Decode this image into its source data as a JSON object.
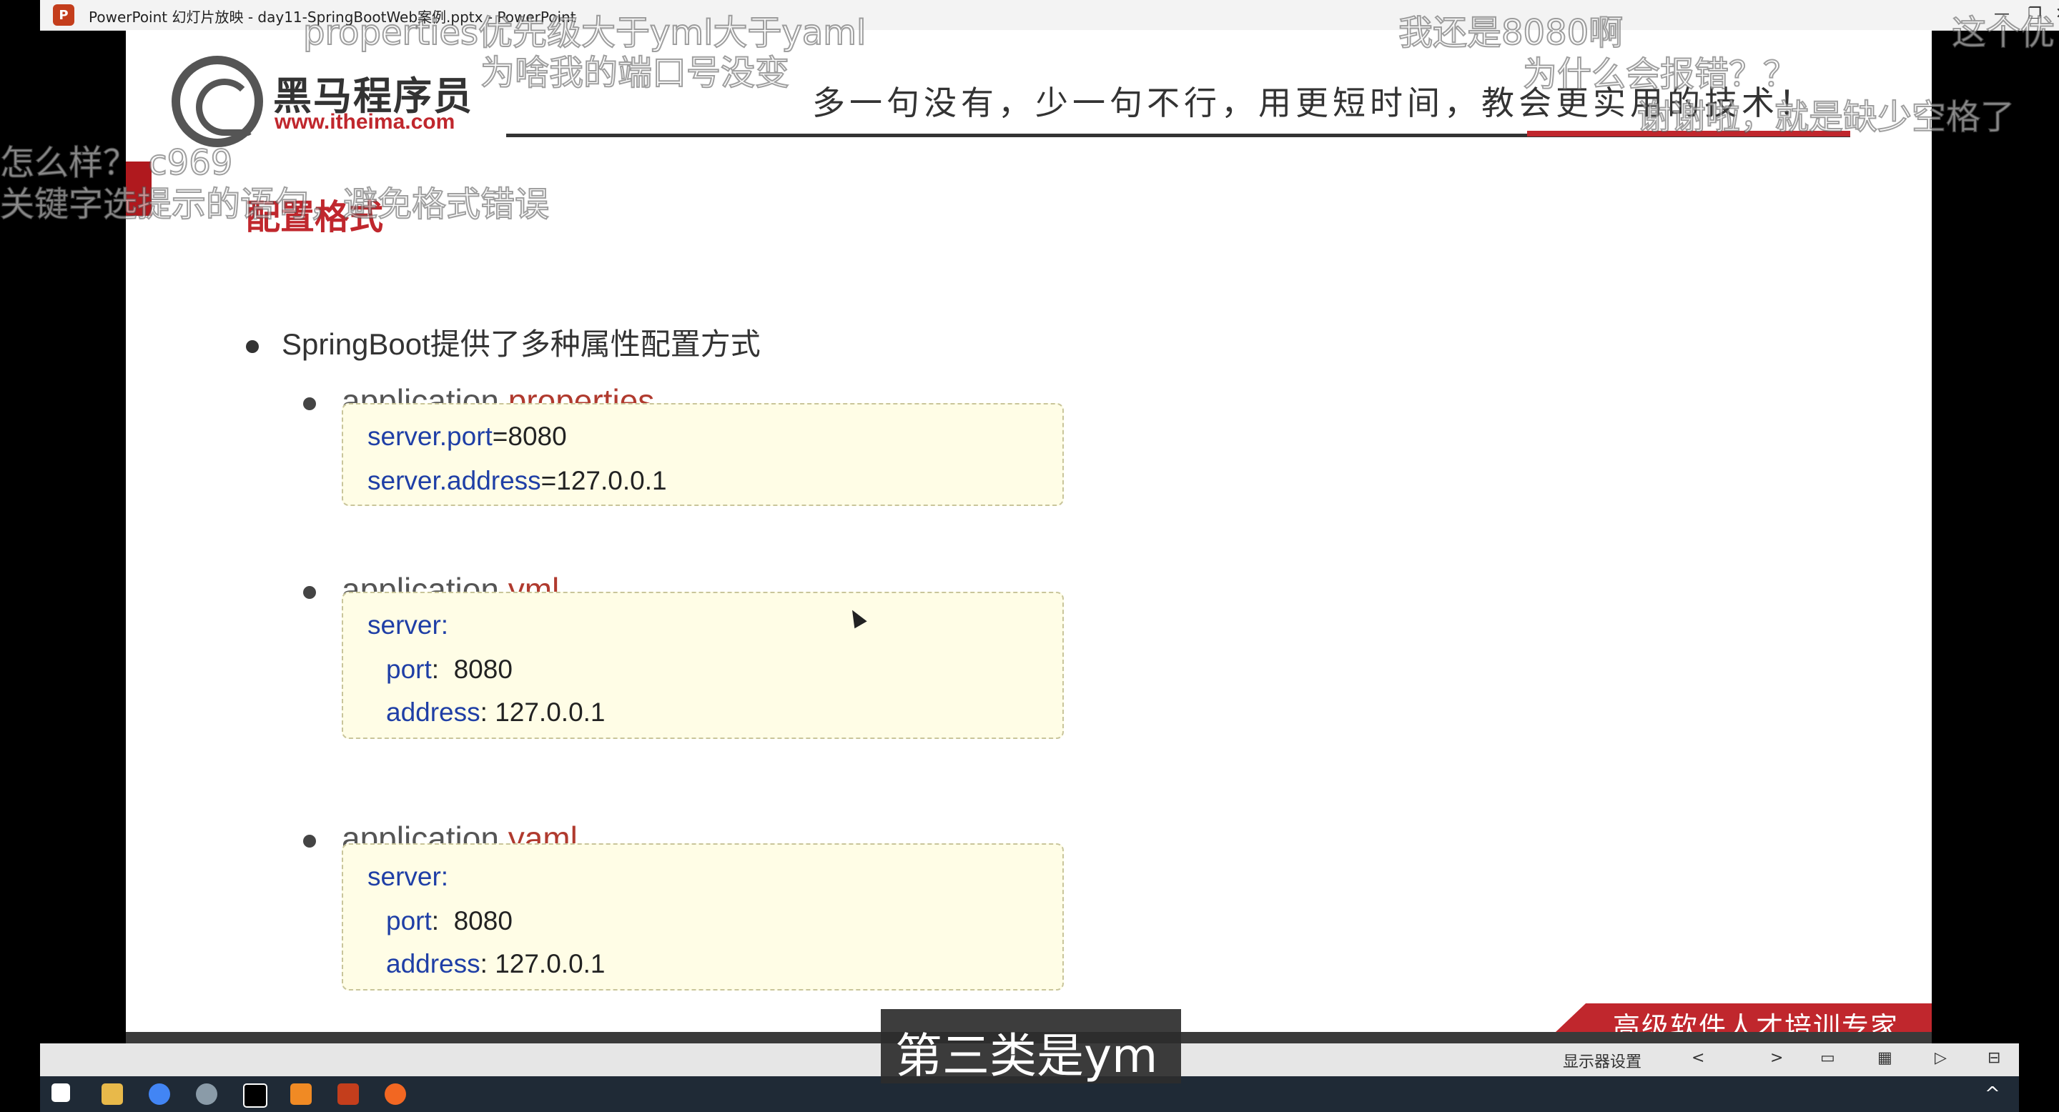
{
  "window": {
    "title": "PowerPoint 幻灯片放映 - day11-SpringBootWeb案例.pptx - PowerPoint",
    "app_icon": "powerpoint-icon",
    "controls": [
      "—",
      "❐",
      "✕"
    ]
  },
  "slide": {
    "brand_name": "黑马程序员",
    "brand_url": "www.itheima.com",
    "slogan": "多一句没有，少一句不行，用更短时间，教会更实用的技术！",
    "section_title": "配置格式",
    "main_bullet": "SpringBoot提供了多种属性配置方式",
    "formats": [
      {
        "prefix": "application.",
        "ext": "properties",
        "lines": [
          {
            "key": "server.port",
            "sep": "=",
            "value": "8080"
          },
          {
            "key": "server.address",
            "sep": "=",
            "value": "127.0.0.1"
          }
        ]
      },
      {
        "prefix": "application.",
        "ext": "yml",
        "lines": [
          {
            "key": "server:",
            "sep": "",
            "value": ""
          },
          {
            "key": "port",
            "sep": ":",
            "value": "8080"
          },
          {
            "key": "address",
            "sep": ":",
            "value": "127.0.0.1"
          }
        ]
      },
      {
        "prefix": "application.",
        "ext": "yaml",
        "lines": [
          {
            "key": "server:",
            "sep": "",
            "value": ""
          },
          {
            "key": "port",
            "sep": ":",
            "value": "8080"
          },
          {
            "key": "address",
            "sep": ":",
            "value": "127.0.0.1"
          }
        ]
      }
    ],
    "banner": "高级软件人才培训专家"
  },
  "statusbar": {
    "display_settings": "显示器设置",
    "nav_prev": "<",
    "nav_next": ">"
  },
  "caption": "第三类是ym",
  "danmaku": [
    "properties优先级大于yml大于yaml",
    "为啥我的端口号没变",
    "我还是8080啊",
    "这个优",
    "为什么会报错？？",
    "谢谢啦，就是缺少空格了",
    "怎么样？ c969",
    "关键字选提示的语句，避免格式错误"
  ],
  "colors": {
    "accent_red": "#c0272d",
    "code_key_blue": "#1f3fa6",
    "code_bg": "#fffde6"
  }
}
